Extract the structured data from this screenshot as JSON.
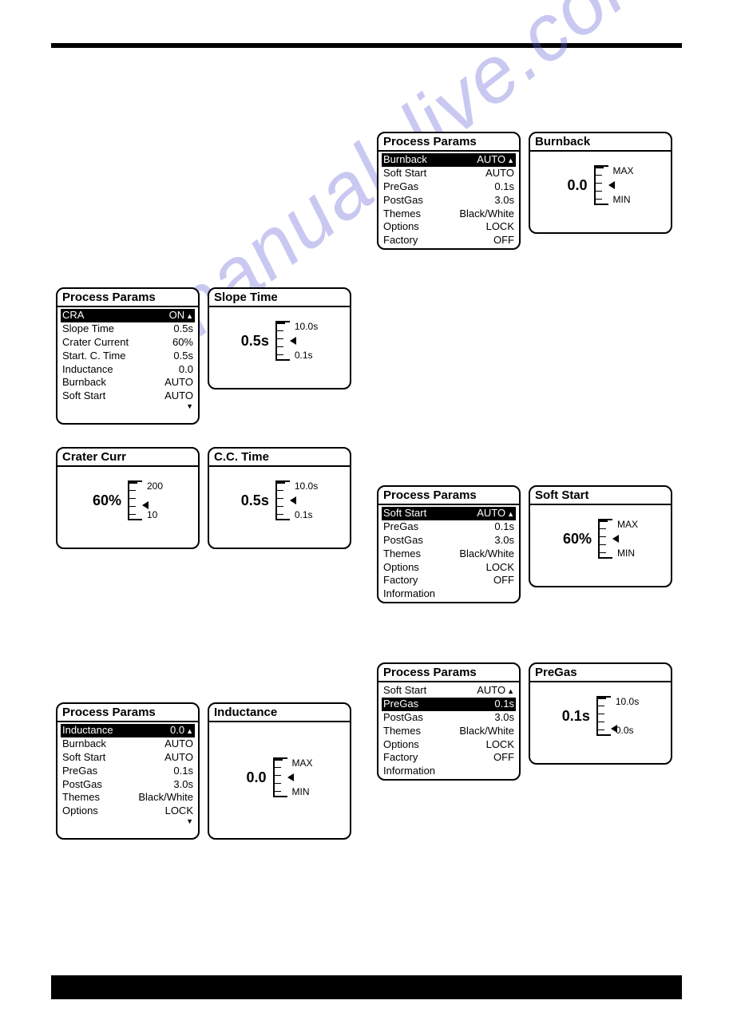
{
  "watermark": "manualslive.com",
  "panels": {
    "pp1": {
      "title": "Process Params",
      "rows": [
        {
          "label": "Burnback",
          "value": "AUTO",
          "selected": true
        },
        {
          "label": "Soft Start",
          "value": "AUTO"
        },
        {
          "label": "PreGas",
          "value": "0.1s"
        },
        {
          "label": "PostGas",
          "value": "3.0s"
        },
        {
          "label": "Themes",
          "value": "Black/White"
        },
        {
          "label": "Options",
          "value": "LOCK"
        },
        {
          "label": "Factory",
          "value": "OFF"
        }
      ]
    },
    "burnback": {
      "title": "Burnback",
      "value": "0.0",
      "max": "MAX",
      "min": "MIN",
      "ptr": 0.5
    },
    "pp2": {
      "title": "Process Params",
      "rows": [
        {
          "label": "CRA",
          "value": "ON",
          "selected": true
        },
        {
          "label": " Slope Time",
          "value": "0.5s"
        },
        {
          "label": " Crater Current",
          "value": "60%"
        },
        {
          "label": " Start. C. Time",
          "value": "0.5s"
        },
        {
          "label": "Inductance",
          "value": "0.0"
        },
        {
          "label": "Burnback",
          "value": "AUTO"
        },
        {
          "label": "Soft Start",
          "value": "AUTO"
        }
      ]
    },
    "slope": {
      "title": "Slope Time",
      "value": "0.5s",
      "max": "10.0s",
      "min": "0.1s",
      "ptr": 0.5
    },
    "crater": {
      "title": "Crater Curr",
      "value": "60%",
      "max": "200",
      "min": "10",
      "ptr": 0.65
    },
    "cctime": {
      "title": "C.C. Time",
      "value": "0.5s",
      "max": "10.0s",
      "min": "0.1s",
      "ptr": 0.5
    },
    "pp3": {
      "title": "Process Params",
      "rows": [
        {
          "label": "Soft Start",
          "value": "AUTO",
          "selected": true
        },
        {
          "label": "PreGas",
          "value": "0.1s"
        },
        {
          "label": "PostGas",
          "value": "3.0s"
        },
        {
          "label": "Themes",
          "value": "Black/White"
        },
        {
          "label": "Options",
          "value": "LOCK"
        },
        {
          "label": "Factory",
          "value": "OFF"
        },
        {
          "label": "Information",
          "value": ""
        }
      ]
    },
    "softstart": {
      "title": "Soft Start",
      "value": "60%",
      "max": "MAX",
      "min": "MIN",
      "ptr": 0.5
    },
    "pp4": {
      "title": "Process Params",
      "rows": [
        {
          "label": "Inductance",
          "value": "0.0",
          "selected": true
        },
        {
          "label": "Burnback",
          "value": "AUTO"
        },
        {
          "label": "Soft Start",
          "value": "AUTO"
        },
        {
          "label": "PreGas",
          "value": "0.1s"
        },
        {
          "label": "PostGas",
          "value": "3.0s"
        },
        {
          "label": "Themes",
          "value": "Black/White"
        },
        {
          "label": "Options",
          "value": "LOCK"
        }
      ]
    },
    "inductance": {
      "title": "Inductance",
      "value": "0.0",
      "max": "MAX",
      "min": "MIN",
      "ptr": 0.5
    },
    "pp5": {
      "title": "Process Params",
      "rows": [
        {
          "label": "Soft Start",
          "value": "AUTO",
          "arrowOnly": true
        },
        {
          "label": "PreGas",
          "value": "0.1s",
          "selected": true
        },
        {
          "label": "PostGas",
          "value": "3.0s"
        },
        {
          "label": "Themes",
          "value": "Black/White"
        },
        {
          "label": "Options",
          "value": "LOCK"
        },
        {
          "label": "Factory",
          "value": "OFF"
        },
        {
          "label": "Information",
          "value": ""
        }
      ]
    },
    "pregas": {
      "title": "PreGas",
      "value": "0.1s",
      "max": "10.0s",
      "min": "0.0s",
      "ptr": 0.9
    }
  }
}
